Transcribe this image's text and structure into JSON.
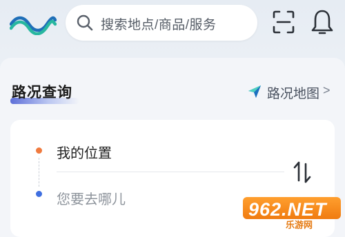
{
  "header": {
    "logo_icon": "wave-logo-icon",
    "search": {
      "placeholder": "搜索地点/商品/服务",
      "icon": "search-icon"
    },
    "scan_icon": "scan-icon",
    "notification_icon": "bell-icon"
  },
  "traffic": {
    "title": "路况查询",
    "map_link": {
      "label": "路况地图",
      "chevron": ">",
      "icon": "map-arrow-icon"
    }
  },
  "route": {
    "origin": "我的位置",
    "destination_placeholder": "您要去哪儿",
    "swap_icon": "swap-arrows-icon"
  },
  "watermark": {
    "brand": "962.NET",
    "site": "乐游网"
  },
  "colors": {
    "accent": "#5e6fd8",
    "origin_dot": "#f07a3e",
    "destination_dot": "#3f6fe0",
    "watermark": "#f07b10"
  }
}
